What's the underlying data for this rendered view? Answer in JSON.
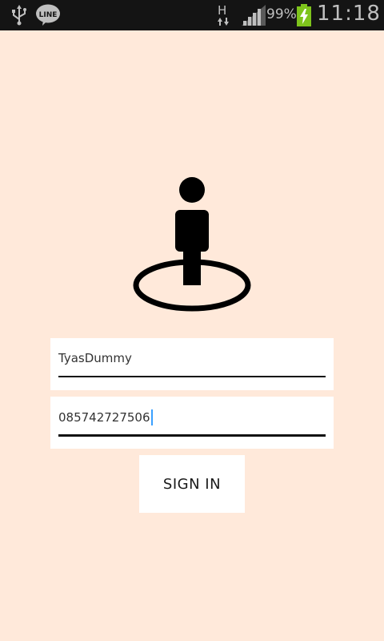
{
  "status_bar": {
    "usb_icon": "usb-icon",
    "line_icon": "line-app-icon",
    "line_label": "LINE",
    "network_type": "H",
    "battery_pct": "99%",
    "time": "11:18"
  },
  "login": {
    "logo_icon": "person-location-icon",
    "username_value": "TyasDummy",
    "password_value": "085742727506",
    "signin_label": "SIGN IN"
  },
  "colors": {
    "background": "#ffe9da",
    "status_bar": "#141414",
    "battery": "#7ec41c",
    "cursor": "#3aa0ff"
  }
}
